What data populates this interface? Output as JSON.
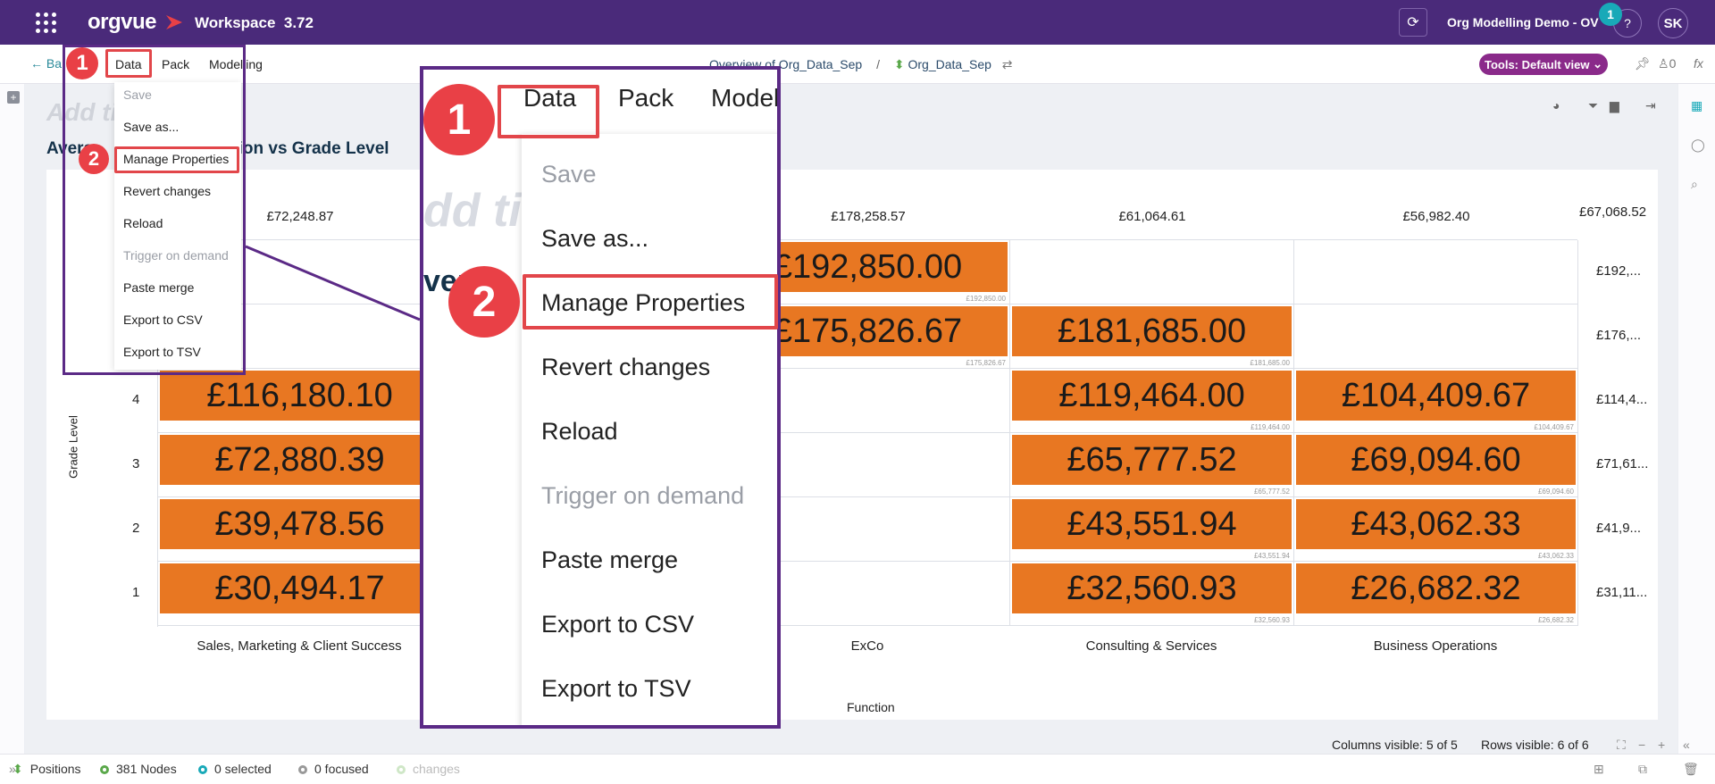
{
  "topbar": {
    "logo": "orgvue",
    "workspace": "Workspace",
    "version": "3.72",
    "org_title": "Org Modelling Demo - OV",
    "notification_count": "1",
    "help": "?",
    "avatar": "SK"
  },
  "toolbar": {
    "back": "← Ba",
    "menu": [
      "Data",
      "Pack",
      "Modelling"
    ],
    "breadcrumb": [
      "Overview of Org_Data_Sep",
      "Org_Data_Sep"
    ],
    "tools_label": "Tools: Default view",
    "count": "0",
    "fx": "fx"
  },
  "chart": {
    "add_title": "Add ti",
    "title": "Avera",
    "title_end": "nction vs Grade Level",
    "y_title": "Grade Level",
    "x_title": "Function"
  },
  "chart_data": {
    "type": "table",
    "title": "Average ... Function vs Grade Level",
    "xlabel": "Function",
    "ylabel": "Grade Level",
    "columns": [
      "Sales, Marketing & Client Success",
      "",
      "ExCo",
      "Consulting & Services",
      "Business Operations"
    ],
    "column_totals": [
      "£72,248.87",
      "",
      "£178,258.57",
      "£61,064.61",
      "£56,982.40"
    ],
    "grand_total": "£67,068.52",
    "rows": [
      "",
      "",
      "4",
      "3",
      "2",
      "1"
    ],
    "row_totals": [
      "£192,...",
      "£176,...",
      "£114,4...",
      "£71,61...",
      "£41,9...",
      "£31,11..."
    ],
    "cells": [
      [
        "",
        "",
        "£192,850.00",
        "",
        ""
      ],
      [
        "",
        "",
        "£175,826.67",
        "£181,685.00",
        ""
      ],
      [
        "£116,180.10",
        "",
        "",
        "£119,464.00",
        "£104,409.67"
      ],
      [
        "£72,880.39",
        "",
        "",
        "£65,777.52",
        "£69,094.60"
      ],
      [
        "£39,478.56",
        "",
        "",
        "£43,551.94",
        "£43,062.33"
      ],
      [
        "£30,494.17",
        "",
        "",
        "£32,560.93",
        "£26,682.32"
      ]
    ],
    "small_labels": [
      [
        "",
        "",
        "£192,850.00",
        "",
        ""
      ],
      [
        "",
        "",
        "£175,826.67",
        "£181,685.00",
        ""
      ],
      [
        "£116,",
        "",
        "",
        "£119,464.00",
        "£104,409.67"
      ],
      [
        "£72,8",
        "",
        "",
        "£65,777.52",
        "£69,094.60"
      ],
      [
        "£39,4",
        "",
        "",
        "£43,551.94",
        "£43,062.33"
      ],
      [
        "£30,4",
        "",
        "",
        "£32,560.93",
        "£26,682.32"
      ]
    ],
    "bar_color": "#e87722"
  },
  "data_menu": {
    "items": [
      "Save",
      "Save as...",
      "Manage Properties",
      "Revert changes",
      "Reload",
      "Trigger on demand",
      "Paste merge",
      "Export to CSV",
      "Export to TSV"
    ],
    "disabled": [
      true,
      false,
      false,
      false,
      false,
      true,
      false,
      false,
      false
    ]
  },
  "zoom": {
    "menu": [
      "Data",
      "Pack",
      "Model"
    ],
    "ghost_title": "dd ti",
    "ghost_ave": "ver"
  },
  "callouts": [
    "1",
    "2"
  ],
  "visibility": {
    "columns": "Columns visible: 5 of 5",
    "rows": "Rows visible: 6 of 6"
  },
  "status": {
    "positions": "Positions",
    "nodes": "381 Nodes",
    "selected": "0 selected",
    "focused": "0 focused",
    "changes": "changes"
  },
  "colors": {
    "topbar": "#4a2a7a",
    "accent": "#8a2a8a",
    "callout": "#e94046",
    "frame": "#5b2a86",
    "bar": "#e87722"
  }
}
